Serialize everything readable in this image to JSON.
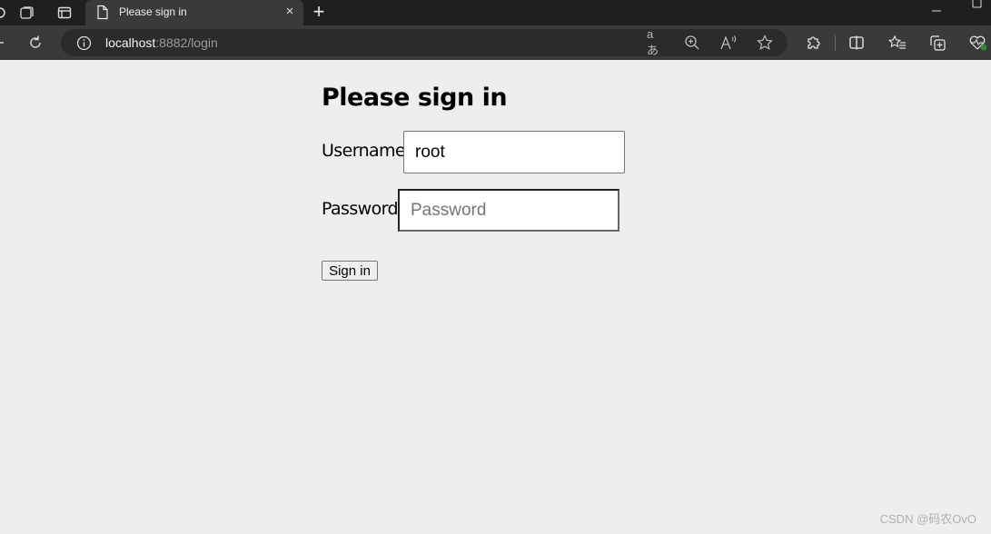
{
  "browser": {
    "tab": {
      "title": "Please sign in",
      "icon": "document-icon",
      "close_label": "×"
    },
    "new_tab_label": "+",
    "address_bar": {
      "host": "localhost",
      "rest": ":8882/login"
    },
    "toolbar_icons": [
      "read-aloud-translate-icon",
      "zoom-icon",
      "read-aloud-icon",
      "favorite-star-icon",
      "extensions-icon",
      "split-screen-icon",
      "favorites-icon",
      "collections-icon",
      "browser-essentials-icon"
    ]
  },
  "page": {
    "heading": "Please sign in",
    "username": {
      "label": "Username",
      "value": "root"
    },
    "password": {
      "label": "Password",
      "value": "",
      "placeholder": "Password"
    },
    "submit_label": "Sign in"
  },
  "watermark": "CSDN @码农OvO"
}
